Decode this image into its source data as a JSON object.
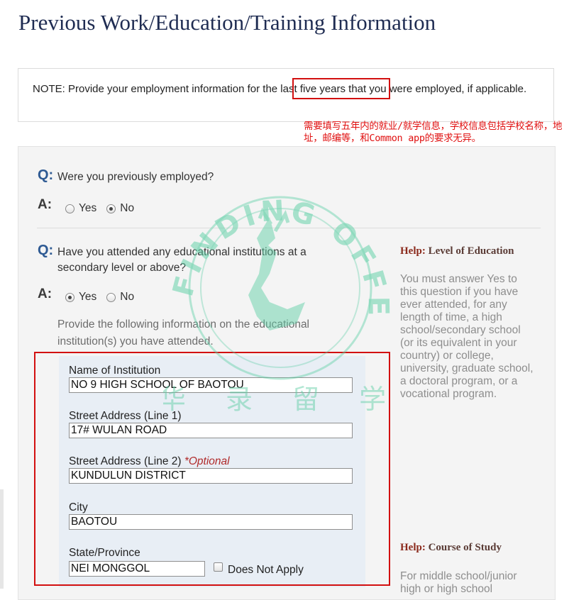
{
  "page": {
    "title": "Previous Work/Education/Training Information"
  },
  "note": {
    "text": "NOTE: Provide your employment information for the last five years that you were employed, if applicable."
  },
  "annotation": {
    "text": "需要填写五年内的就业/就学信息，学校信息包括学校名称，地址，邮编等，和Common app的要求无异。"
  },
  "labels": {
    "q": "Q:",
    "a": "A:"
  },
  "questions": {
    "employed": {
      "question": "Were you previously employed?",
      "yes_label": "Yes",
      "no_label": "No",
      "selected": "No"
    },
    "education": {
      "question": "Have you attended any educational institutions at a secondary level or above?",
      "yes_label": "Yes",
      "no_label": "No",
      "selected": "Yes",
      "instructions": "Provide the following information on the educational institution(s) you have attended."
    }
  },
  "education_form": {
    "institution_label": "Name of Institution",
    "institution_value": "NO 9 HIGH SCHOOL OF BAOTOU",
    "street1_label": "Street Address (Line 1)",
    "street1_value": "17# WULAN ROAD",
    "street2_label": "Street Address (Line 2)",
    "street2_optional": "*Optional",
    "street2_value": "KUNDULUN DISTRICT",
    "city_label": "City",
    "city_value": "BAOTOU",
    "state_label": "State/Province",
    "state_value": "NEI MONGGOL",
    "does_not_apply_label": "Does Not Apply"
  },
  "help": {
    "help_word": "Help:",
    "level_title": "Level of Education",
    "level_text": "You must answer Yes to this question if you have ever attended, for any length of time, a high school/secondary school (or its equivalent in your country) or college, university, graduate school, a doctoral program, or a vocational program.",
    "course_title": "Course of Study",
    "course_text": "For middle school/junior high or high school"
  },
  "watermark": {
    "ring_text": "FINDING OFFER",
    "bottom_text": "华 录 留 学"
  },
  "colors": {
    "title": "#1f2c52",
    "q_label": "#2e5a93",
    "highlight": "#d21010",
    "annotation": "#e01010",
    "watermark": "#5fcfa6"
  }
}
